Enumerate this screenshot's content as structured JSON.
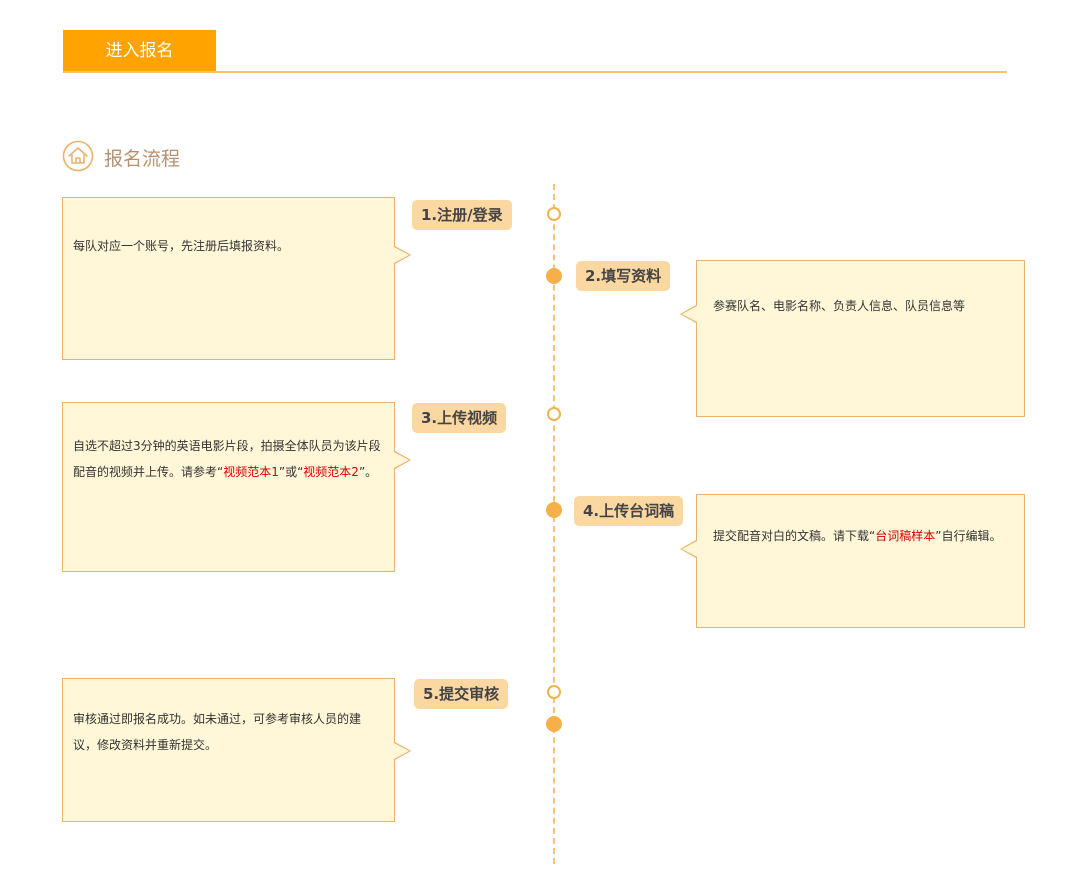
{
  "tab": {
    "label": "进入报名"
  },
  "section": {
    "title": "报名流程",
    "icon": "house-icon"
  },
  "steps": [
    {
      "label": "1.注册/登录",
      "desc": "每队对应一个账号，先注册后填报资料。"
    },
    {
      "label": "2.填写资料",
      "desc": "参赛队名、电影名称、负责人信息、队员信息等"
    },
    {
      "label": "3.上传视频",
      "desc_a": "自选不超过3分钟的英语电影片段，拍摄全体队员为该片段配音的视频并上传。请参考“",
      "link1": "视频范本1",
      "desc_b": "”或“",
      "link2": "视频范本2",
      "desc_c": "”。"
    },
    {
      "label": "4.上传台词稿",
      "desc_a": "提交配音对白的文稿。请下载“",
      "link1": "台词稿样本",
      "desc_b": "”自行编辑。"
    },
    {
      "label": "5.提交审核",
      "desc": "审核通过即报名成功。如未通过，可参考审核人员的建议，修改资料并重新提交。"
    }
  ],
  "colors": {
    "accent": "#ffa300",
    "card_bg": "#fff7d8",
    "card_border": "#e9b36b",
    "label_bg": "#fbd7a1",
    "link": "#d40000"
  }
}
